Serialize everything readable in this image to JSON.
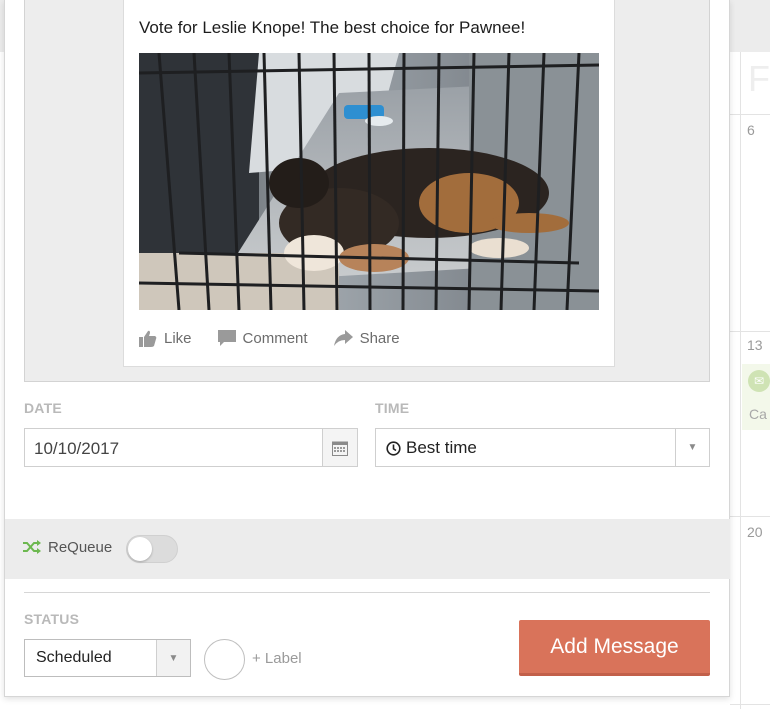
{
  "post": {
    "text": "Vote for Leslie Knope! The best choice for Pawnee!",
    "image_alt": "Puppy sleeping in a wire crate",
    "actions": {
      "like": "Like",
      "comment": "Comment",
      "share": "Share"
    }
  },
  "schedule": {
    "date_label": "DATE",
    "date_value": "10/10/2017",
    "time_label": "TIME",
    "time_value": "Best time"
  },
  "requeue": {
    "label": "ReQueue",
    "enabled": false
  },
  "status": {
    "label": "STATUS",
    "value": "Scheduled",
    "add_label": "+ Label"
  },
  "submit": {
    "label": "Add Message",
    "color": "#d9735a"
  },
  "calendar": {
    "days": [
      "6",
      "13",
      "20"
    ],
    "header_letter": "F",
    "event_text": "Ca"
  },
  "colors": {
    "requeue_icon": "#6cb84f",
    "button": "#d9735a"
  }
}
